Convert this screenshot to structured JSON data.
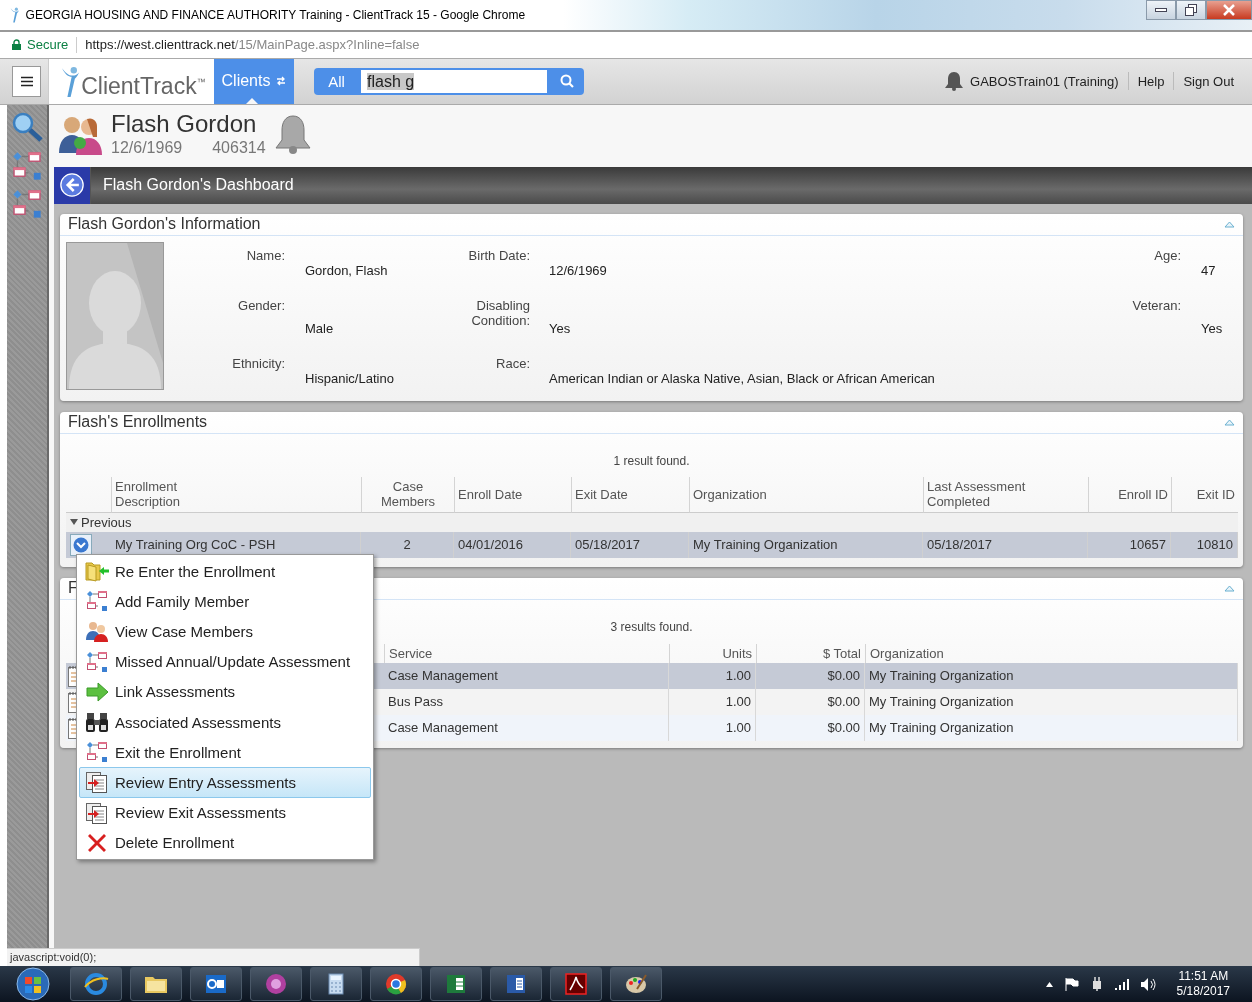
{
  "browser": {
    "title": "GEORGIA HOUSING AND FINANCE AUTHORITY Training - ClientTrack 15 - Google Chrome",
    "security": "Secure",
    "url_host": "https://west.clienttrack.net",
    "url_path": "/15/MainPage.aspx?Inline=false"
  },
  "header": {
    "logo": "ClientTrack$^{™}$",
    "module": "Clients",
    "search": {
      "scope": "All",
      "value": "flash g"
    },
    "user": "GABOSTrain01 (Training)",
    "links": [
      "Help",
      "Sign Out"
    ]
  },
  "client": {
    "name": "Flash Gordon",
    "birth_date": "12/6/1969",
    "client_id": "406314"
  },
  "dashboard": {
    "title": "Flash Gordon's Dashboard"
  },
  "info_panel": {
    "title": "Flash Gordon's Information",
    "fields": [
      {
        "label": "Name:",
        "value": "Gordon, Flash"
      },
      {
        "label": "Birth Date:",
        "value": "12/6/1969"
      },
      {
        "label": "Age:",
        "value": "47"
      },
      {
        "label": "Gender:",
        "value": "Male"
      },
      {
        "label": "Disabling Condition:",
        "value": "Yes"
      },
      {
        "label": "Veteran:",
        "value": "Yes"
      },
      {
        "label": "Ethnicity:",
        "value": "Hispanic/Latino"
      },
      {
        "label": "Race:",
        "value": "American Indian or Alaska Native, Asian, Black or African American"
      }
    ]
  },
  "enrollments": {
    "title": "Flash's Enrollments",
    "result_count": "1 result found.",
    "columns": [
      "Enrollment Description",
      "Case Members",
      "Enroll Date",
      "Exit Date",
      "Organization",
      "Last Assessment Completed",
      "Enroll ID",
      "Exit ID"
    ],
    "groups": [
      {
        "label": "Previous",
        "expanded": true,
        "rows": [
          {
            "selected": true,
            "cells": [
              "My Training Org CoC - PSH",
              "2",
              "04/01/2016",
              "05/18/2017",
              "My Training Organization",
              "05/18/2017",
              "10657",
              "10810"
            ]
          }
        ]
      }
    ]
  },
  "services": {
    "title": "F",
    "result_count": "3 results found.",
    "columns": [
      "Service",
      "Units",
      "$ Total",
      "Organization"
    ],
    "rows": [
      {
        "selected": true,
        "cells": [
          "Case Management",
          "1.00",
          "$0.00",
          "My Training Organization"
        ]
      },
      {
        "selected": false,
        "cells": [
          "Bus Pass",
          "1.00",
          "$0.00",
          "My Training Organization"
        ]
      },
      {
        "selected": false,
        "cells": [
          "Case Management",
          "1.00",
          "$0.00",
          "My Training Organization"
        ]
      }
    ]
  },
  "context_menu": {
    "items": [
      {
        "label": "Re Enter the Enrollment",
        "kind": "reenter",
        "selected": false
      },
      {
        "label": "Add Family Member",
        "kind": "workflow",
        "selected": false
      },
      {
        "label": "View Case Members",
        "kind": "members",
        "selected": false
      },
      {
        "label": "Missed Annual/Update Assessment",
        "kind": "workflow",
        "selected": false
      },
      {
        "label": "Link Assessments",
        "kind": "link",
        "selected": false
      },
      {
        "label": "Associated Assessments",
        "kind": "find",
        "selected": false
      },
      {
        "label": "Exit the Enrollment",
        "kind": "workflow",
        "selected": false
      },
      {
        "label": "Review Entry Assessments",
        "kind": "review",
        "selected": true
      },
      {
        "label": "Review Exit Assessments",
        "kind": "review",
        "selected": false
      },
      {
        "label": "Delete Enrollment",
        "kind": "delete",
        "selected": false
      }
    ]
  },
  "status_url": "javascript:void(0);",
  "taskbar": {
    "time": "11:51 AM",
    "date": "5/18/2017"
  }
}
